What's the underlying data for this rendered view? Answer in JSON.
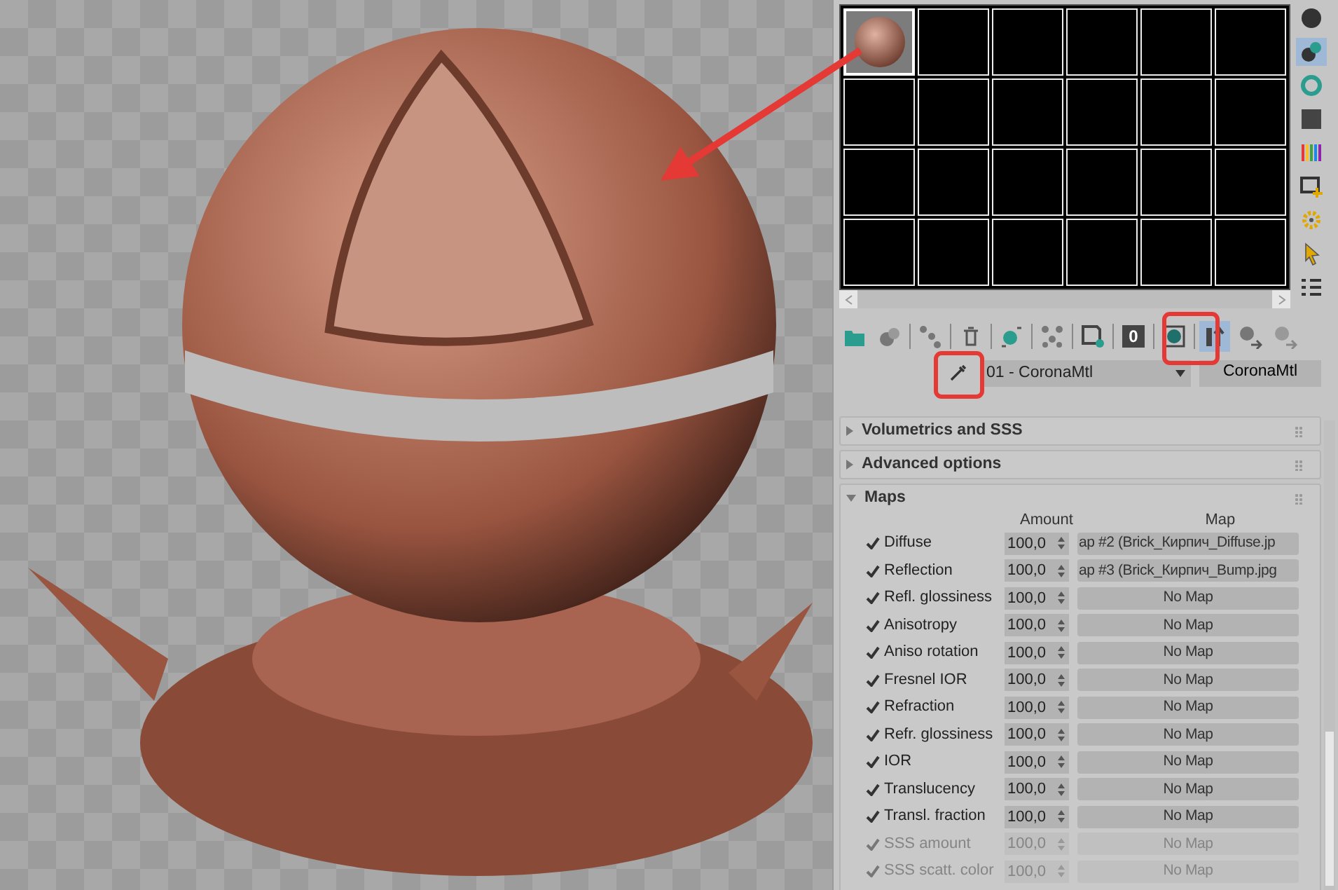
{
  "sample_slots": [
    {
      "kind": "sphere",
      "selected": true
    },
    {
      "kind": "empty",
      "selected": false
    },
    {
      "kind": "empty",
      "selected": false
    },
    {
      "kind": "empty",
      "selected": false
    },
    {
      "kind": "empty",
      "selected": false
    },
    {
      "kind": "empty",
      "selected": false
    },
    {
      "kind": "empty",
      "selected": false
    },
    {
      "kind": "empty",
      "selected": false
    },
    {
      "kind": "empty",
      "selected": false
    },
    {
      "kind": "empty",
      "selected": false
    },
    {
      "kind": "empty",
      "selected": false
    },
    {
      "kind": "empty",
      "selected": false
    },
    {
      "kind": "empty",
      "selected": false
    },
    {
      "kind": "empty",
      "selected": false
    },
    {
      "kind": "empty",
      "selected": false
    },
    {
      "kind": "empty",
      "selected": false
    },
    {
      "kind": "empty",
      "selected": false
    },
    {
      "kind": "empty",
      "selected": false
    },
    {
      "kind": "empty",
      "selected": false
    },
    {
      "kind": "empty",
      "selected": false
    },
    {
      "kind": "empty",
      "selected": false
    },
    {
      "kind": "empty",
      "selected": false
    },
    {
      "kind": "empty",
      "selected": false
    },
    {
      "kind": "empty",
      "selected": false
    }
  ],
  "side_toolbar": [
    {
      "selected": false
    },
    {
      "selected": true
    },
    {
      "selected": false
    },
    {
      "selected": false
    },
    {
      "selected": false
    },
    {
      "selected": false
    },
    {
      "selected": false
    },
    {
      "selected": false
    },
    {
      "selected": false
    }
  ],
  "bottom_toolbar": [
    {
      "kind": "icon",
      "on": false
    },
    {
      "kind": "icon",
      "on": false
    },
    {
      "kind": "icon",
      "on": false
    },
    {
      "kind": "icon",
      "on": false
    },
    {
      "kind": "icon",
      "on": false
    },
    {
      "kind": "icon",
      "on": false
    },
    {
      "kind": "icon",
      "on": false
    },
    {
      "kind": "text",
      "label": "0",
      "on": false
    },
    {
      "kind": "icon",
      "on": false
    },
    {
      "kind": "icon",
      "on": true
    },
    {
      "kind": "icon",
      "on": false
    },
    {
      "kind": "icon",
      "on": false
    }
  ],
  "material_name": {
    "value": "01 - CoronaMtl",
    "type": "CoronaMtl"
  },
  "rollouts": [
    {
      "title": "Volumetrics and SSS",
      "expanded": false
    },
    {
      "title": "Advanced options",
      "expanded": false
    },
    {
      "title": "Maps",
      "expanded": true
    }
  ],
  "maps": {
    "columns": [
      "Amount",
      "Map"
    ],
    "rows": [
      {
        "label": "Diffuse",
        "checked": true,
        "amount": "100,0",
        "map": "ap #2 (Brick_Кирпич_Diffuse.jp",
        "disabled": false
      },
      {
        "label": "Reflection",
        "checked": true,
        "amount": "100,0",
        "map": "ap #3 (Brick_Кирпич_Bump.jpg",
        "disabled": false
      },
      {
        "label": "Refl. glossiness",
        "checked": true,
        "amount": "100,0",
        "map": "No Map",
        "disabled": false
      },
      {
        "label": "Anisotropy",
        "checked": true,
        "amount": "100,0",
        "map": "No Map",
        "disabled": false
      },
      {
        "label": "Aniso rotation",
        "checked": true,
        "amount": "100,0",
        "map": "No Map",
        "disabled": false
      },
      {
        "label": "Fresnel IOR",
        "checked": true,
        "amount": "100,0",
        "map": "No Map",
        "disabled": false
      },
      {
        "label": "Refraction",
        "checked": true,
        "amount": "100,0",
        "map": "No Map",
        "disabled": false
      },
      {
        "label": "Refr. glossiness",
        "checked": true,
        "amount": "100,0",
        "map": "No Map",
        "disabled": false
      },
      {
        "label": "IOR",
        "checked": true,
        "amount": "100,0",
        "map": "No Map",
        "disabled": false
      },
      {
        "label": "Translucency",
        "checked": true,
        "amount": "100,0",
        "map": "No Map",
        "disabled": false
      },
      {
        "label": "Transl. fraction",
        "checked": true,
        "amount": "100,0",
        "map": "No Map",
        "disabled": false
      },
      {
        "label": "SSS amount",
        "checked": true,
        "amount": "100,0",
        "map": "No Map",
        "disabled": true
      },
      {
        "label": "SSS scatt. color",
        "checked": true,
        "amount": "100,0",
        "map": "No Map",
        "disabled": true
      }
    ]
  }
}
